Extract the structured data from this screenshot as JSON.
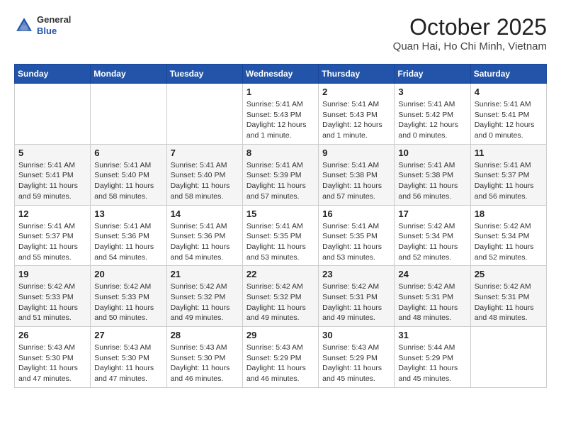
{
  "header": {
    "logo": {
      "line1": "General",
      "line2": "Blue"
    },
    "title": "October 2025",
    "location": "Quan Hai, Ho Chi Minh, Vietnam"
  },
  "days_of_week": [
    "Sunday",
    "Monday",
    "Tuesday",
    "Wednesday",
    "Thursday",
    "Friday",
    "Saturday"
  ],
  "weeks": [
    [
      {
        "day": "",
        "info": ""
      },
      {
        "day": "",
        "info": ""
      },
      {
        "day": "",
        "info": ""
      },
      {
        "day": "1",
        "info": "Sunrise: 5:41 AM\nSunset: 5:43 PM\nDaylight: 12 hours\nand 1 minute."
      },
      {
        "day": "2",
        "info": "Sunrise: 5:41 AM\nSunset: 5:43 PM\nDaylight: 12 hours\nand 1 minute."
      },
      {
        "day": "3",
        "info": "Sunrise: 5:41 AM\nSunset: 5:42 PM\nDaylight: 12 hours\nand 0 minutes."
      },
      {
        "day": "4",
        "info": "Sunrise: 5:41 AM\nSunset: 5:41 PM\nDaylight: 12 hours\nand 0 minutes."
      }
    ],
    [
      {
        "day": "5",
        "info": "Sunrise: 5:41 AM\nSunset: 5:41 PM\nDaylight: 11 hours\nand 59 minutes."
      },
      {
        "day": "6",
        "info": "Sunrise: 5:41 AM\nSunset: 5:40 PM\nDaylight: 11 hours\nand 58 minutes."
      },
      {
        "day": "7",
        "info": "Sunrise: 5:41 AM\nSunset: 5:40 PM\nDaylight: 11 hours\nand 58 minutes."
      },
      {
        "day": "8",
        "info": "Sunrise: 5:41 AM\nSunset: 5:39 PM\nDaylight: 11 hours\nand 57 minutes."
      },
      {
        "day": "9",
        "info": "Sunrise: 5:41 AM\nSunset: 5:38 PM\nDaylight: 11 hours\nand 57 minutes."
      },
      {
        "day": "10",
        "info": "Sunrise: 5:41 AM\nSunset: 5:38 PM\nDaylight: 11 hours\nand 56 minutes."
      },
      {
        "day": "11",
        "info": "Sunrise: 5:41 AM\nSunset: 5:37 PM\nDaylight: 11 hours\nand 56 minutes."
      }
    ],
    [
      {
        "day": "12",
        "info": "Sunrise: 5:41 AM\nSunset: 5:37 PM\nDaylight: 11 hours\nand 55 minutes."
      },
      {
        "day": "13",
        "info": "Sunrise: 5:41 AM\nSunset: 5:36 PM\nDaylight: 11 hours\nand 54 minutes."
      },
      {
        "day": "14",
        "info": "Sunrise: 5:41 AM\nSunset: 5:36 PM\nDaylight: 11 hours\nand 54 minutes."
      },
      {
        "day": "15",
        "info": "Sunrise: 5:41 AM\nSunset: 5:35 PM\nDaylight: 11 hours\nand 53 minutes."
      },
      {
        "day": "16",
        "info": "Sunrise: 5:41 AM\nSunset: 5:35 PM\nDaylight: 11 hours\nand 53 minutes."
      },
      {
        "day": "17",
        "info": "Sunrise: 5:42 AM\nSunset: 5:34 PM\nDaylight: 11 hours\nand 52 minutes."
      },
      {
        "day": "18",
        "info": "Sunrise: 5:42 AM\nSunset: 5:34 PM\nDaylight: 11 hours\nand 52 minutes."
      }
    ],
    [
      {
        "day": "19",
        "info": "Sunrise: 5:42 AM\nSunset: 5:33 PM\nDaylight: 11 hours\nand 51 minutes."
      },
      {
        "day": "20",
        "info": "Sunrise: 5:42 AM\nSunset: 5:33 PM\nDaylight: 11 hours\nand 50 minutes."
      },
      {
        "day": "21",
        "info": "Sunrise: 5:42 AM\nSunset: 5:32 PM\nDaylight: 11 hours\nand 49 minutes."
      },
      {
        "day": "22",
        "info": "Sunrise: 5:42 AM\nSunset: 5:32 PM\nDaylight: 11 hours\nand 49 minutes."
      },
      {
        "day": "23",
        "info": "Sunrise: 5:42 AM\nSunset: 5:31 PM\nDaylight: 11 hours\nand 49 minutes."
      },
      {
        "day": "24",
        "info": "Sunrise: 5:42 AM\nSunset: 5:31 PM\nDaylight: 11 hours\nand 48 minutes."
      },
      {
        "day": "25",
        "info": "Sunrise: 5:42 AM\nSunset: 5:31 PM\nDaylight: 11 hours\nand 48 minutes."
      }
    ],
    [
      {
        "day": "26",
        "info": "Sunrise: 5:43 AM\nSunset: 5:30 PM\nDaylight: 11 hours\nand 47 minutes."
      },
      {
        "day": "27",
        "info": "Sunrise: 5:43 AM\nSunset: 5:30 PM\nDaylight: 11 hours\nand 47 minutes."
      },
      {
        "day": "28",
        "info": "Sunrise: 5:43 AM\nSunset: 5:30 PM\nDaylight: 11 hours\nand 46 minutes."
      },
      {
        "day": "29",
        "info": "Sunrise: 5:43 AM\nSunset: 5:29 PM\nDaylight: 11 hours\nand 46 minutes."
      },
      {
        "day": "30",
        "info": "Sunrise: 5:43 AM\nSunset: 5:29 PM\nDaylight: 11 hours\nand 45 minutes."
      },
      {
        "day": "31",
        "info": "Sunrise: 5:44 AM\nSunset: 5:29 PM\nDaylight: 11 hours\nand 45 minutes."
      },
      {
        "day": "",
        "info": ""
      }
    ]
  ]
}
